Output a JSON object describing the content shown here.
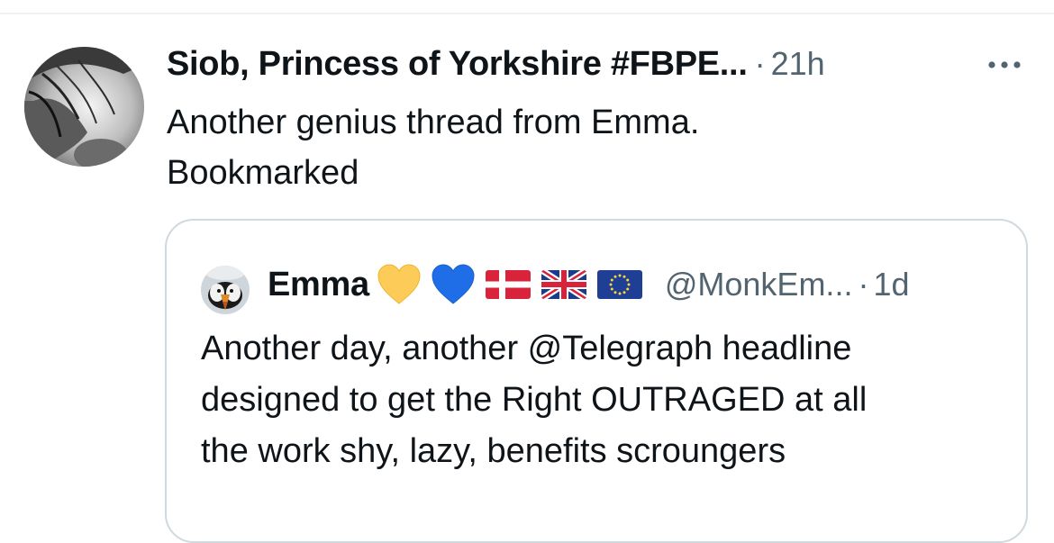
{
  "post": {
    "author_name": "Siob, Princess of Yorkshire #FBPE...",
    "separator": "·",
    "time": "21h",
    "text": "Another genius thread from Emma.\nBookmarked",
    "more_icon": "more-horizontal-icon"
  },
  "quoted": {
    "author_name": "Emma",
    "emojis": [
      "yellow-heart-icon",
      "blue-heart-icon",
      "denmark-flag-icon",
      "uk-flag-icon",
      "eu-flag-icon"
    ],
    "handle": "@MonkEm...",
    "separator": "·",
    "time": "1d",
    "text": "Another day, another @Telegraph headline\ndesigned to get the Right OUTRAGED at all\nthe work shy, lazy, benefits scroungers"
  },
  "colors": {
    "text_primary": "#0f1419",
    "text_secondary": "#536471",
    "border": "#cfd9de",
    "divider": "#eff3f4",
    "yellow_heart": "#fdcb58",
    "blue_heart": "#1f6ee8"
  }
}
